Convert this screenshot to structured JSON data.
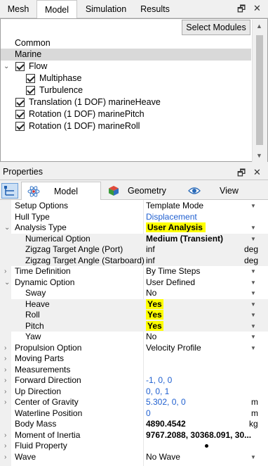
{
  "top_tabs": [
    {
      "label": "Mesh"
    },
    {
      "label": "Model"
    },
    {
      "label": "Simulation"
    },
    {
      "label": "Results"
    }
  ],
  "window_controls": {
    "restore": "🗗",
    "close": "✕"
  },
  "model_tree": {
    "select_modules_label": "Select Modules",
    "items": [
      {
        "label": "Common"
      },
      {
        "label": "Marine"
      },
      {
        "label": "Flow"
      },
      {
        "label": "Multiphase"
      },
      {
        "label": "Turbulence"
      },
      {
        "label": "Translation (1 DOF) marineHeave"
      },
      {
        "label": "Rotation (1 DOF) marinePitch"
      },
      {
        "label": "Rotation (1 DOF) marineRoll"
      }
    ]
  },
  "properties": {
    "title": "Properties",
    "sub_tabs": [
      {
        "label": "Model",
        "icon": "atom-icon"
      },
      {
        "label": "Geometry",
        "icon": "cube-icon"
      },
      {
        "label": "View",
        "icon": "eye-icon"
      }
    ],
    "rows": [
      {
        "label": "Setup Options",
        "value": "Template Mode"
      },
      {
        "label": "Hull Type",
        "value": "Displacement"
      },
      {
        "label": "Analysis Type",
        "value": "User Analysis"
      },
      {
        "label": "Numerical Option",
        "value": "Medium (Transient)"
      },
      {
        "label": "Zigzag Target Angle (Port)",
        "value": "inf",
        "unit": "deg"
      },
      {
        "label": "Zigzag Target Angle (Starboard)",
        "value": "inf",
        "unit": "deg"
      },
      {
        "label": "Time Definition",
        "value": "By Time Steps"
      },
      {
        "label": "Dynamic Option",
        "value": "User Defined"
      },
      {
        "label": "Sway",
        "value": "No"
      },
      {
        "label": "Heave",
        "value": "Yes"
      },
      {
        "label": "Roll",
        "value": "Yes"
      },
      {
        "label": "Pitch",
        "value": "Yes"
      },
      {
        "label": "Yaw",
        "value": "No"
      },
      {
        "label": "Propulsion Option",
        "value": "Velocity Profile"
      },
      {
        "label": "Moving Parts",
        "value": ""
      },
      {
        "label": "Measurements",
        "value": ""
      },
      {
        "label": "Forward Direction",
        "value": "-1, 0, 0"
      },
      {
        "label": "Up Direction",
        "value": "0, 0, 1"
      },
      {
        "label": "Center of Gravity",
        "value": "5.302, 0, 0",
        "unit": "m"
      },
      {
        "label": "Waterline Position",
        "value": "0",
        "unit": "m"
      },
      {
        "label": "Body Mass",
        "value": "4890.4542",
        "unit": "kg"
      },
      {
        "label": "Moment of Inertia",
        "value": "9767.2088, 30368.091, 30..."
      },
      {
        "label": "Fluid Property",
        "value": ""
      },
      {
        "label": "Wave",
        "value": "No Wave"
      }
    ]
  }
}
